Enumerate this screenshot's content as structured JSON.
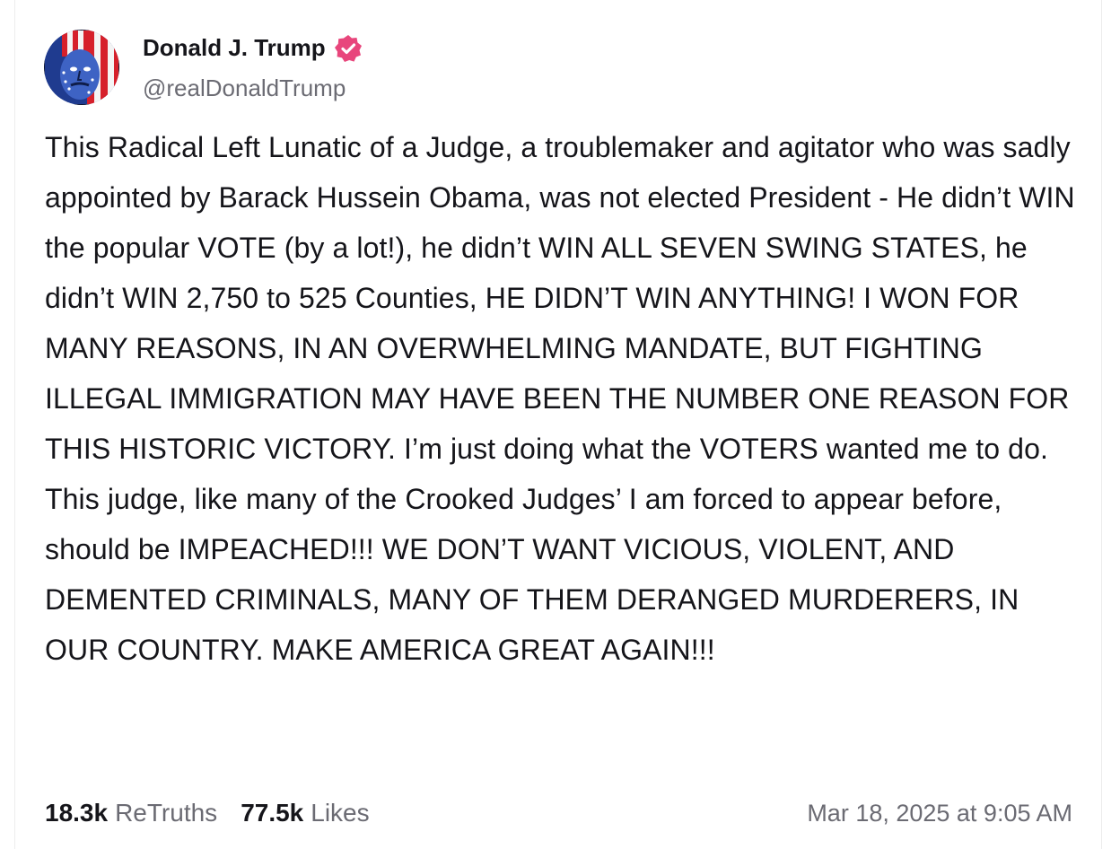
{
  "author": {
    "display_name": "Donald J. Trump",
    "handle": "@realDonaldTrump",
    "verified_icon": "verified-badge-icon",
    "verified_color": "#e8467c",
    "avatar": "profile-avatar-flag-portrait"
  },
  "post": {
    "text": "This Radical Left Lunatic of a Judge, a troublemaker and agitator who was sadly appointed by Barack Hussein Obama, was not elected President - He didn’t WIN the popular VOTE (by a lot!), he didn’t WIN ALL SEVEN SWING STATES, he didn’t WIN 2,750 to 525 Counties, HE DIDN’T WIN ANYTHING! I WON FOR MANY REASONS, IN AN OVERWHELMING MANDATE, BUT FIGHTING ILLEGAL IMMIGRATION MAY HAVE BEEN THE NUMBER ONE REASON FOR THIS HISTORIC VICTORY. I’m just doing what the VOTERS wanted me to do. This judge, like many of the Crooked Judges’ I am forced to appear before, should be IMPEACHED!!! WE DON’T WANT VICIOUS, VIOLENT, AND DEMENTED CRIMINALS, MANY OF THEM DERANGED MURDERERS, IN OUR COUNTRY. MAKE AMERICA GREAT AGAIN!!!"
  },
  "stats": {
    "retruths_count": "18.3k",
    "retruths_label": "ReTruths",
    "likes_count": "77.5k",
    "likes_label": "Likes"
  },
  "timestamp": "Mar 18, 2025 at 9:05 AM",
  "colors": {
    "text": "#15151a",
    "muted": "#6b6b73",
    "border": "#ececec"
  }
}
